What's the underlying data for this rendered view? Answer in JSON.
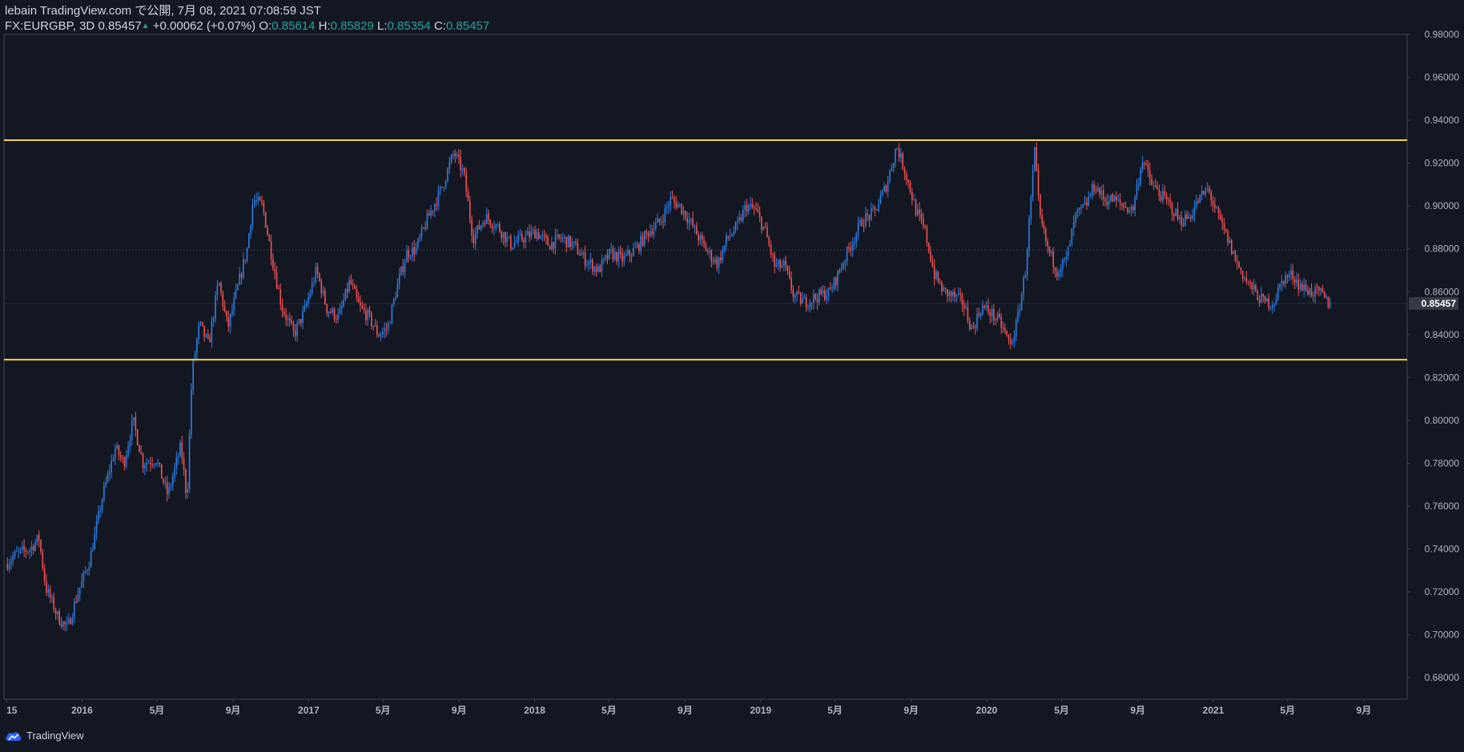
{
  "header": {
    "line1": "lebain TradingView.com で公開, 7月 08, 2021 07:08:59 JST",
    "symbol": "FX:EURGBP, 3D",
    "last": "0.85457",
    "change_arrow": "▲",
    "change": "+0.00062 (+0.07%)",
    "o_label": "O:",
    "o_val": "0.85614",
    "h_label": "H:",
    "h_val": "0.85829",
    "l_label": "L:",
    "l_val": "0.85354",
    "c_label": "C:",
    "c_val": "0.85457"
  },
  "footer": {
    "brand": "TradingView",
    "logo_icon": "tradingview-cloud-icon"
  },
  "colors": {
    "background": "#131722",
    "up": "#2f7de1",
    "down": "#ef5350",
    "level_line": "#f5d33d",
    "axis_text": "#b2b5be",
    "grid_border": "#434651",
    "price_tag_bg": "#363a45"
  },
  "chart_data": {
    "type": "candlestick",
    "symbol": "FX:EURGBP",
    "interval": "3D",
    "y_axis": {
      "range": [
        0.67,
        0.98
      ],
      "ticks": [
        0.98,
        0.96,
        0.94,
        0.92,
        0.9,
        0.88,
        0.86,
        0.84,
        0.82,
        0.8,
        0.78,
        0.76,
        0.74,
        0.72,
        0.7,
        0.68
      ],
      "tick_labels": [
        "0.98000",
        "0.96000",
        "0.94000",
        "0.92000",
        "0.90000",
        "0.88000",
        "0.86000",
        "0.84000",
        "0.82000",
        "0.80000",
        "0.78000",
        "0.76000",
        "0.74000",
        "0.72000",
        "0.70000",
        "0.68000"
      ],
      "position": "right"
    },
    "x_axis": {
      "labels": [
        {
          "text": "15",
          "date": "2015-09-01"
        },
        {
          "text": "2016",
          "date": "2016-01-01"
        },
        {
          "text": "5月",
          "date": "2016-05-01"
        },
        {
          "text": "9月",
          "date": "2016-09-01"
        },
        {
          "text": "2017",
          "date": "2017-01-01"
        },
        {
          "text": "5月",
          "date": "2017-05-01"
        },
        {
          "text": "9月",
          "date": "2017-09-01"
        },
        {
          "text": "2018",
          "date": "2018-01-01"
        },
        {
          "text": "5月",
          "date": "2018-05-01"
        },
        {
          "text": "9月",
          "date": "2018-09-01"
        },
        {
          "text": "2019",
          "date": "2019-01-01"
        },
        {
          "text": "5月",
          "date": "2019-05-01"
        },
        {
          "text": "9月",
          "date": "2019-09-01"
        },
        {
          "text": "2020",
          "date": "2020-01-01"
        },
        {
          "text": "5月",
          "date": "2020-05-01"
        },
        {
          "text": "9月",
          "date": "2020-09-01"
        },
        {
          "text": "2021",
          "date": "2021-01-01"
        },
        {
          "text": "5月",
          "date": "2021-05-01"
        },
        {
          "text": "9月",
          "date": "2021-09-01"
        }
      ],
      "date_range": [
        "2015-08-28",
        "2021-11-10"
      ]
    },
    "horizontal_levels": [
      0.9307,
      0.8283
    ],
    "dotted_reference_level": 0.8795,
    "current_price": 0.85457,
    "current_price_label": "0.85457",
    "price_path": [
      [
        "2015-09-01",
        0.733
      ],
      [
        "2015-09-20",
        0.738
      ],
      [
        "2015-10-10",
        0.74
      ],
      [
        "2015-10-25",
        0.745
      ],
      [
        "2015-11-05",
        0.722
      ],
      [
        "2015-11-25",
        0.708
      ],
      [
        "2015-12-10",
        0.703
      ],
      [
        "2015-12-25",
        0.718
      ],
      [
        "2016-01-15",
        0.735
      ],
      [
        "2016-02-05",
        0.765
      ],
      [
        "2016-02-25",
        0.787
      ],
      [
        "2016-03-10",
        0.78
      ],
      [
        "2016-03-25",
        0.8
      ],
      [
        "2016-04-10",
        0.78
      ],
      [
        "2016-05-01",
        0.782
      ],
      [
        "2016-05-20",
        0.765
      ],
      [
        "2016-06-10",
        0.788
      ],
      [
        "2016-06-20",
        0.763
      ],
      [
        "2016-06-28",
        0.822
      ],
      [
        "2016-07-10",
        0.845
      ],
      [
        "2016-07-25",
        0.835
      ],
      [
        "2016-08-10",
        0.865
      ],
      [
        "2016-08-25",
        0.843
      ],
      [
        "2016-09-10",
        0.862
      ],
      [
        "2016-09-25",
        0.88
      ],
      [
        "2016-10-05",
        0.903
      ],
      [
        "2016-10-20",
        0.9
      ],
      [
        "2016-11-05",
        0.875
      ],
      [
        "2016-11-20",
        0.853
      ],
      [
        "2016-12-10",
        0.84
      ],
      [
        "2016-12-28",
        0.852
      ],
      [
        "2017-01-15",
        0.87
      ],
      [
        "2017-02-01",
        0.852
      ],
      [
        "2017-02-20",
        0.848
      ],
      [
        "2017-03-10",
        0.865
      ],
      [
        "2017-03-25",
        0.853
      ],
      [
        "2017-04-10",
        0.848
      ],
      [
        "2017-04-25",
        0.84
      ],
      [
        "2017-05-10",
        0.843
      ],
      [
        "2017-05-25",
        0.862
      ],
      [
        "2017-06-10",
        0.878
      ],
      [
        "2017-06-25",
        0.88
      ],
      [
        "2017-07-15",
        0.895
      ],
      [
        "2017-08-05",
        0.908
      ],
      [
        "2017-08-25",
        0.925
      ],
      [
        "2017-09-10",
        0.915
      ],
      [
        "2017-09-25",
        0.885
      ],
      [
        "2017-10-15",
        0.895
      ],
      [
        "2017-11-05",
        0.89
      ],
      [
        "2017-11-25",
        0.882
      ],
      [
        "2017-12-15",
        0.885
      ],
      [
        "2018-01-05",
        0.888
      ],
      [
        "2018-01-25",
        0.882
      ],
      [
        "2018-02-15",
        0.885
      ],
      [
        "2018-03-05",
        0.882
      ],
      [
        "2018-03-25",
        0.875
      ],
      [
        "2018-04-15",
        0.87
      ],
      [
        "2018-05-05",
        0.878
      ],
      [
        "2018-05-25",
        0.875
      ],
      [
        "2018-06-15",
        0.88
      ],
      [
        "2018-07-05",
        0.888
      ],
      [
        "2018-07-25",
        0.893
      ],
      [
        "2018-08-10",
        0.903
      ],
      [
        "2018-08-25",
        0.9
      ],
      [
        "2018-09-10",
        0.893
      ],
      [
        "2018-09-25",
        0.885
      ],
      [
        "2018-10-10",
        0.878
      ],
      [
        "2018-10-25",
        0.873
      ],
      [
        "2018-11-10",
        0.885
      ],
      [
        "2018-11-25",
        0.89
      ],
      [
        "2018-12-10",
        0.9
      ],
      [
        "2018-12-25",
        0.898
      ],
      [
        "2019-01-10",
        0.888
      ],
      [
        "2019-01-25",
        0.872
      ],
      [
        "2019-02-10",
        0.872
      ],
      [
        "2019-02-25",
        0.858
      ],
      [
        "2019-03-15",
        0.855
      ],
      [
        "2019-04-05",
        0.858
      ],
      [
        "2019-04-25",
        0.86
      ],
      [
        "2019-05-10",
        0.87
      ],
      [
        "2019-05-25",
        0.88
      ],
      [
        "2019-06-15",
        0.893
      ],
      [
        "2019-07-05",
        0.897
      ],
      [
        "2019-07-25",
        0.91
      ],
      [
        "2019-08-10",
        0.928
      ],
      [
        "2019-08-25",
        0.915
      ],
      [
        "2019-09-10",
        0.898
      ],
      [
        "2019-09-25",
        0.888
      ],
      [
        "2019-10-10",
        0.868
      ],
      [
        "2019-10-25",
        0.86
      ],
      [
        "2019-11-10",
        0.858
      ],
      [
        "2019-11-25",
        0.855
      ],
      [
        "2019-12-10",
        0.842
      ],
      [
        "2019-12-25",
        0.853
      ],
      [
        "2020-01-10",
        0.85
      ],
      [
        "2020-01-25",
        0.845
      ],
      [
        "2020-02-10",
        0.835
      ],
      [
        "2020-02-20",
        0.845
      ],
      [
        "2020-03-05",
        0.87
      ],
      [
        "2020-03-20",
        0.925
      ],
      [
        "2020-03-28",
        0.895
      ],
      [
        "2020-04-10",
        0.88
      ],
      [
        "2020-04-25",
        0.87
      ],
      [
        "2020-05-10",
        0.875
      ],
      [
        "2020-05-25",
        0.895
      ],
      [
        "2020-06-10",
        0.9
      ],
      [
        "2020-06-25",
        0.91
      ],
      [
        "2020-07-10",
        0.903
      ],
      [
        "2020-07-25",
        0.903
      ],
      [
        "2020-08-10",
        0.9
      ],
      [
        "2020-08-25",
        0.898
      ],
      [
        "2020-09-10",
        0.922
      ],
      [
        "2020-09-25",
        0.91
      ],
      [
        "2020-10-10",
        0.905
      ],
      [
        "2020-10-25",
        0.9
      ],
      [
        "2020-11-10",
        0.893
      ],
      [
        "2020-11-25",
        0.895
      ],
      [
        "2020-12-10",
        0.903
      ],
      [
        "2020-12-25",
        0.908
      ],
      [
        "2021-01-10",
        0.895
      ],
      [
        "2021-01-25",
        0.885
      ],
      [
        "2021-02-10",
        0.873
      ],
      [
        "2021-02-25",
        0.865
      ],
      [
        "2021-03-10",
        0.86
      ],
      [
        "2021-03-25",
        0.855
      ],
      [
        "2021-04-10",
        0.855
      ],
      [
        "2021-04-25",
        0.866
      ],
      [
        "2021-05-10",
        0.868
      ],
      [
        "2021-05-25",
        0.862
      ],
      [
        "2021-06-10",
        0.86
      ],
      [
        "2021-06-25",
        0.859
      ],
      [
        "2021-07-07",
        0.8546
      ]
    ]
  }
}
